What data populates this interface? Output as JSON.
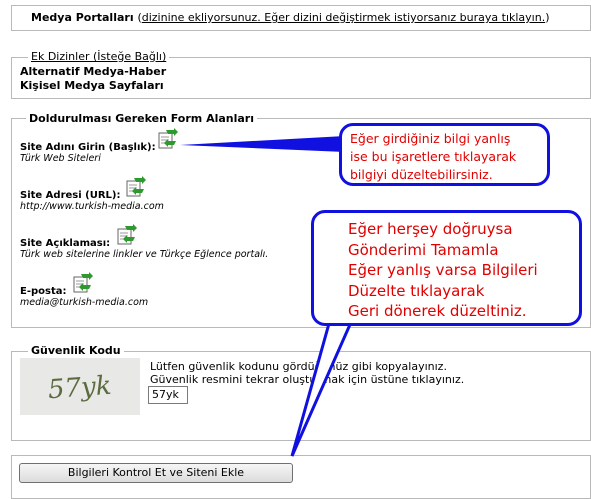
{
  "portal": {
    "title": "Medya Portalları",
    "note_open": "(",
    "note_link": "dizinine ekliyorsunuz. Eğer dizini değiştirmek istiyorsanız buraya tıklayın.",
    "note_close": ")"
  },
  "extra_dirs": {
    "legend": "Ek Dizinler (İsteğe Bağlı)",
    "items": [
      "Alternatif Medya-Haber",
      "Kişisel Medya Sayfaları"
    ]
  },
  "form": {
    "legend": "Doldurulması Gereken Form Alanları",
    "fields": [
      {
        "label": "Site Adını Girin (Başlık):",
        "value": "Türk Web Siteleri"
      },
      {
        "label": "Site Adresi (URL):",
        "value": "http://www.turkish-media.com"
      },
      {
        "label": "Site Açıklaması:",
        "value": "Türk web sitelerine linkler ve Türkçe Eğlence portalı."
      },
      {
        "label": "E-posta:",
        "value": "media@turkish-media.com"
      }
    ]
  },
  "callouts": {
    "edit_hint": [
      "Eğer girdiğiniz bilgi yanlış",
      "ise bu işaretlere tıklayarak",
      "bilgiyi düzeltebilirsiniz."
    ],
    "submit_hint": [
      "Eğer herşey doğruysa",
      "Gönderimi Tamamla",
      "Eğer yanlış varsa Bilgileri",
      "Düzelte tıklayarak",
      "Geri dönerek düzeltiniz."
    ]
  },
  "security": {
    "legend": "Güvenlik Kodu",
    "line1": "Lütfen güvenlik kodunu gördüğünüz gibi kopyalayınız.",
    "line2": "Güvenlik resmini tekrar oluşturmak için üstüne tıklayınız.",
    "captcha_text": "57yk",
    "input_value": "57yk"
  },
  "submit": {
    "label": "Bilgileri Kontrol Et ve Siteni Ekle"
  },
  "colors": {
    "callout_border": "#1010e0",
    "callout_text": "#e00000",
    "fieldset_border": "#b9b9b9",
    "edit_icon_green": "#2e9a2e"
  }
}
